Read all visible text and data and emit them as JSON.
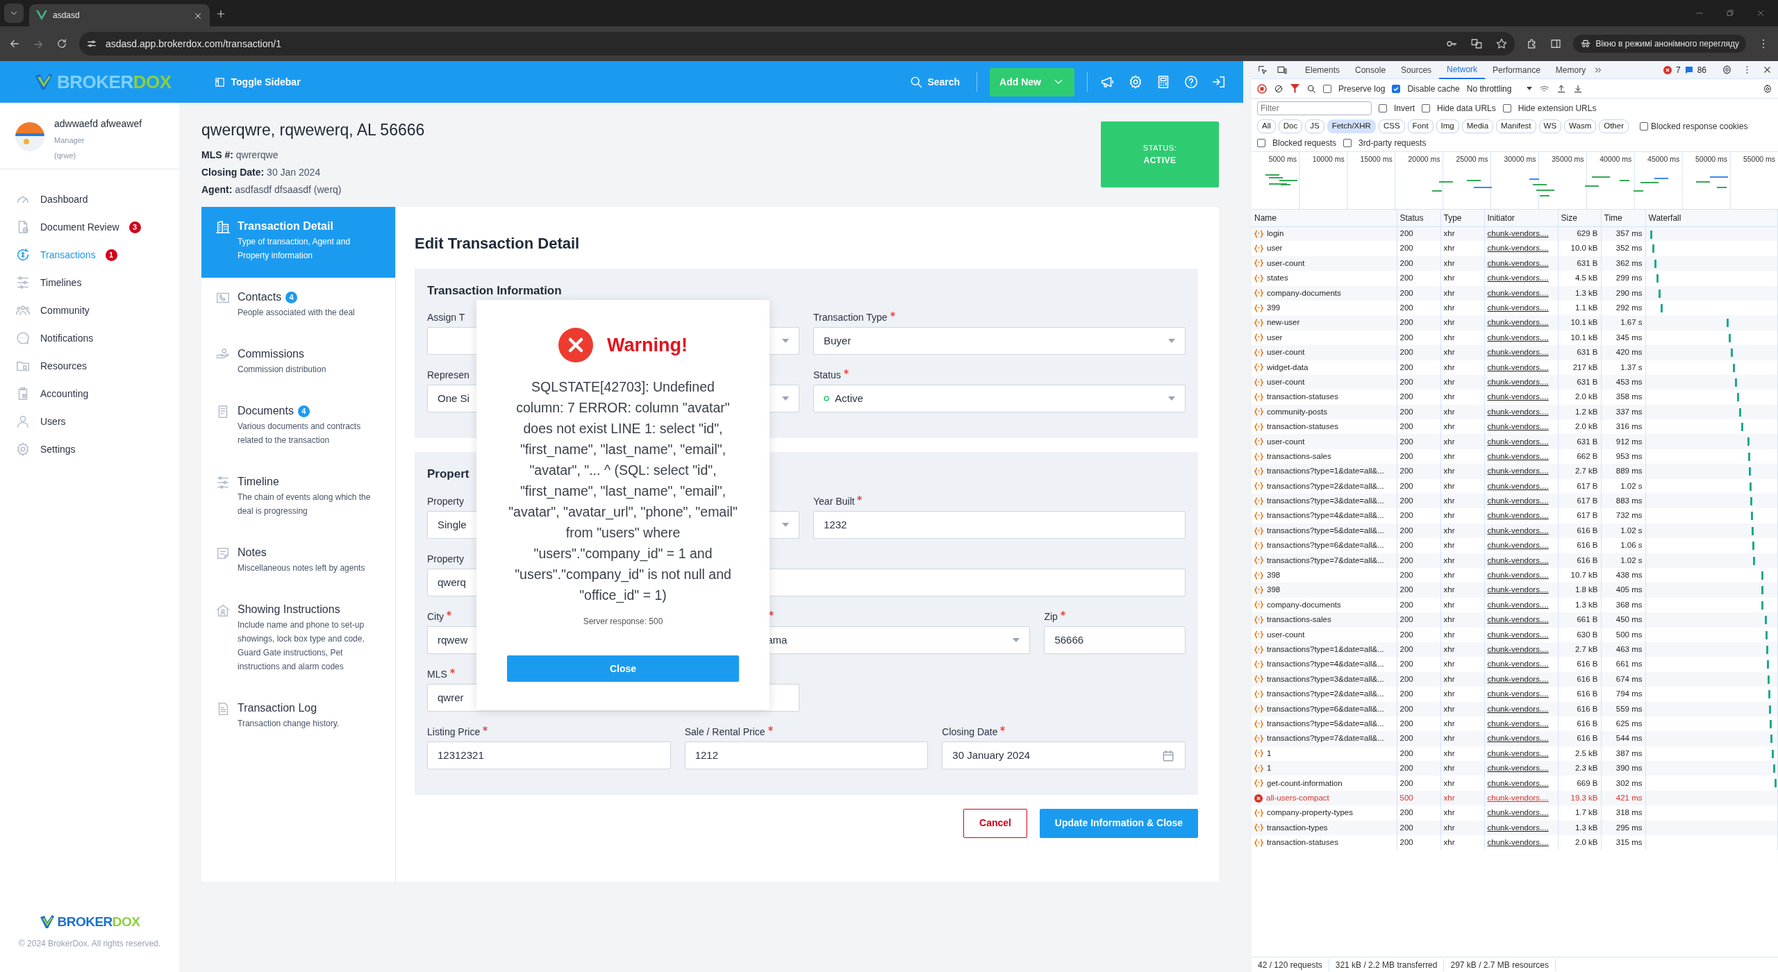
{
  "browser": {
    "tab_title": "asdasd",
    "url": "asdasd.app.brokerdox.com/transaction/1",
    "incognito_label": "Вікно в режимі анонімного перегляду"
  },
  "app": {
    "logo": {
      "part_1": "BROKER",
      "part_2": "DOX"
    },
    "toggle_sidebar": "Toggle Sidebar",
    "search": "Search",
    "add_new": "Add New",
    "user": {
      "name": "adwwaefd afweawef",
      "role": "Manager",
      "office": "(qrwe)"
    },
    "sidebar": {
      "items": [
        {
          "label": "Dashboard",
          "selected": false
        },
        {
          "label": "Document Review",
          "badge": "3",
          "selected": false
        },
        {
          "label": "Transactions",
          "badge": "1",
          "selected": true
        },
        {
          "label": "Timelines",
          "selected": false
        },
        {
          "label": "Community",
          "selected": false
        },
        {
          "label": "Notifications",
          "selected": false
        },
        {
          "label": "Resources",
          "selected": false
        },
        {
          "label": "Accounting",
          "selected": false
        },
        {
          "label": "Users",
          "selected": false
        },
        {
          "label": "Settings",
          "selected": false
        }
      ]
    },
    "footer": {
      "logo": {
        "part_1": "BROKER",
        "part_2": "DOX"
      },
      "copyright": "© 2024 BrokerDox. All rights reserved."
    },
    "transaction": {
      "title": "qwerqwre, rqwewerq, AL 56666",
      "details": [
        "**MLS #:** qwrerqwe",
        "**Closing Date:** 30 Jan 2024",
        "**Agent:** asdfasdf dfsaasdf (werq)"
      ],
      "status": {
        "label": "STATUS:",
        "value": "ACTIVE"
      }
    },
    "detail_nav": [
      {
        "title": "Transaction Detail",
        "description": "Type of transaction, Agent and Property information",
        "selected": true
      },
      {
        "title": "Contacts",
        "badge": "4",
        "description": "People associated with the deal",
        "selected": false
      },
      {
        "title": "Commissions",
        "description": "Commission distribution",
        "selected": false
      },
      {
        "title": "Documents",
        "badge": "4",
        "description": "Various documents and contracts related to the transaction",
        "selected": false
      },
      {
        "title": "Timeline",
        "description": "The chain of events along which the deal is progressing",
        "selected": false
      },
      {
        "title": "Notes",
        "description": "Miscellaneous notes left by agents",
        "selected": false
      },
      {
        "title": "Showing Instructions",
        "description": "Include name and phone to set-up showings, lock box type and code, Guard Gate instructions, Pet instructions and alarm codes",
        "selected": false
      },
      {
        "title": "Transaction Log",
        "description": "Transaction change history.",
        "selected": false
      }
    ],
    "form": {
      "title": "Edit Transaction Detail",
      "sections": [
        {
          "title": "Transaction Information",
          "rows": [
            {
              "kind": "pair",
              "fields": [
                {
                  "label": "Assign T",
                  "required": false,
                  "kind": "select"
                },
                {
                  "label": "Transaction Type",
                  "required": true,
                  "value": "Buyer",
                  "kind": "select"
                }
              ]
            },
            {
              "kind": "pair",
              "fields": [
                {
                  "label": "Represen",
                  "required": false,
                  "value": "One Si",
                  "kind": "select"
                },
                {
                  "label": "Status",
                  "required": true,
                  "value": "Active",
                  "kind": "status"
                }
              ]
            }
          ]
        },
        {
          "title": "Propert",
          "rows": [
            {
              "kind": "pair",
              "fields": [
                {
                  "label": "Property",
                  "required": false,
                  "value": "Single",
                  "kind": "select"
                },
                {
                  "label": "Year Built",
                  "required": true,
                  "value": "1232",
                  "kind": "input"
                }
              ]
            },
            {
              "kind": "wide",
              "fields": [
                {
                  "label": "Property",
                  "required": false,
                  "value": "qwerq",
                  "kind": "input"
                }
              ]
            },
            {
              "kind": "address",
              "fields": [
                {
                  "label": "City",
                  "required": true,
                  "value": "rqwew",
                  "kind": "input"
                },
                {
                  "required": true,
                  "value": "ama",
                  "kind": "covered-select"
                },
                {
                  "label": "Zip",
                  "required": true,
                  "value": "56666",
                  "kind": "input"
                }
              ]
            },
            {
              "kind": "half",
              "fields": [
                {
                  "label": "MLS",
                  "required": true,
                  "value": "qwrer",
                  "kind": "input"
                }
              ]
            },
            {
              "kind": "triple",
              "fields": [
                {
                  "label": "Listing Price",
                  "required": true,
                  "value": "12312321",
                  "kind": "input"
                },
                {
                  "label": "Sale / Rental Price",
                  "required": true,
                  "value": "1212",
                  "kind": "input"
                },
                {
                  "label": "Closing Date",
                  "required": true,
                  "value": "30 January 2024",
                  "kind": "date"
                }
              ]
            }
          ]
        }
      ],
      "cancel": "Cancel",
      "submit": "Update Information & Close"
    },
    "modal": {
      "title": "Warning!",
      "message": "SQLSTATE[42703]: Undefined column: 7 ERROR: column \"avatar\" does not exist LINE 1: select \"id\", \"first_name\", \"last_name\", \"email\", \"avatar\", \"... ^ (SQL: select \"id\", \"first_name\", \"last_name\", \"email\", \"avatar\", \"avatar_url\", \"phone\", \"email\" from \"users\" where \"users\".\"company_id\" = 1 and \"users\".\"company_id\" is not null and \"office_id\" = 1)",
      "server_response": "Server response: 500",
      "close": "Close"
    }
  },
  "devtools": {
    "tabs": [
      {
        "label": "Elements",
        "selected": false
      },
      {
        "label": "Console",
        "selected": false
      },
      {
        "label": "Sources",
        "selected": false
      },
      {
        "label": "Network",
        "selected": true
      },
      {
        "label": "Performance",
        "selected": false
      },
      {
        "label": "Memory",
        "selected": false
      }
    ],
    "error_count": "7",
    "message_count": "86",
    "preserve_log": {
      "label": "Preserve log",
      "checked": false
    },
    "disable_cache": {
      "label": "Disable cache",
      "checked": true
    },
    "throttling": "No throttling",
    "filter": {
      "placeholder": "Filter"
    },
    "filter_options": [
      {
        "label": "Invert",
        "checked": false
      },
      {
        "label": "Hide data URLs",
        "checked": false
      },
      {
        "label": "Hide extension URLs",
        "checked": false
      }
    ],
    "type_filters": [
      {
        "label": "All",
        "selected": false
      },
      {
        "label": "Doc",
        "selected": false
      },
      {
        "label": "JS",
        "selected": false
      },
      {
        "label": "Fetch/XHR",
        "selected": true
      },
      {
        "label": "CSS",
        "selected": false
      },
      {
        "label": "Font",
        "selected": false
      },
      {
        "label": "Img",
        "selected": false
      },
      {
        "label": "Media",
        "selected": false
      },
      {
        "label": "Manifest",
        "selected": false
      },
      {
        "label": "WS",
        "selected": false
      },
      {
        "label": "Wasm",
        "selected": false
      },
      {
        "label": "Other",
        "selected": false
      }
    ],
    "blocked_cookies": {
      "label": "Blocked response cookies",
      "checked": false
    },
    "request_options": [
      {
        "label": "Blocked requests",
        "checked": false
      },
      {
        "label": "3rd-party requests",
        "checked": false
      }
    ],
    "overview_ticks": [
      "5000 ms",
      "10000 ms",
      "15000 ms",
      "20000 ms",
      "25000 ms",
      "30000 ms",
      "35000 ms",
      "40000 ms",
      "45000 ms",
      "50000 ms",
      "55000 ms"
    ],
    "columns": [
      "Name",
      "Status",
      "Type",
      "Initiator",
      "Size",
      "Time",
      "Waterfall"
    ],
    "requests": [
      {
        "name": "login",
        "status": "200",
        "type": "xhr",
        "initiator": "chunk-vendors....",
        "size": "629 B",
        "time": "357 ms",
        "failed": false
      },
      {
        "name": "user",
        "status": "200",
        "type": "xhr",
        "initiator": "chunk-vendors....",
        "size": "10.0 kB",
        "time": "352 ms",
        "failed": false
      },
      {
        "name": "user-count",
        "status": "200",
        "type": "xhr",
        "initiator": "chunk-vendors....",
        "size": "631 B",
        "time": "362 ms",
        "failed": false
      },
      {
        "name": "states",
        "status": "200",
        "type": "xhr",
        "initiator": "chunk-vendors....",
        "size": "4.5 kB",
        "time": "299 ms",
        "failed": false
      },
      {
        "name": "company-documents",
        "status": "200",
        "type": "xhr",
        "initiator": "chunk-vendors....",
        "size": "1.3 kB",
        "time": "290 ms",
        "failed": false
      },
      {
        "name": "399",
        "status": "200",
        "type": "xhr",
        "initiator": "chunk-vendors....",
        "size": "1.1 kB",
        "time": "292 ms",
        "failed": false
      },
      {
        "name": "new-user",
        "status": "200",
        "type": "xhr",
        "initiator": "chunk-vendors....",
        "size": "10.1 kB",
        "time": "1.67 s",
        "failed": false
      },
      {
        "name": "user",
        "status": "200",
        "type": "xhr",
        "initiator": "chunk-vendors....",
        "size": "10.1 kB",
        "time": "345 ms",
        "failed": false
      },
      {
        "name": "user-count",
        "status": "200",
        "type": "xhr",
        "initiator": "chunk-vendors....",
        "size": "631 B",
        "time": "420 ms",
        "failed": false
      },
      {
        "name": "widget-data",
        "status": "200",
        "type": "xhr",
        "initiator": "chunk-vendors....",
        "size": "217 kB",
        "time": "1.37 s",
        "failed": false
      },
      {
        "name": "user-count",
        "status": "200",
        "type": "xhr",
        "initiator": "chunk-vendors....",
        "size": "631 B",
        "time": "453 ms",
        "failed": false
      },
      {
        "name": "transaction-statuses",
        "status": "200",
        "type": "xhr",
        "initiator": "chunk-vendors....",
        "size": "2.0 kB",
        "time": "358 ms",
        "failed": false
      },
      {
        "name": "community-posts",
        "status": "200",
        "type": "xhr",
        "initiator": "chunk-vendors....",
        "size": "1.2 kB",
        "time": "337 ms",
        "failed": false
      },
      {
        "name": "transaction-statuses",
        "status": "200",
        "type": "xhr",
        "initiator": "chunk-vendors....",
        "size": "2.0 kB",
        "time": "316 ms",
        "failed": false
      },
      {
        "name": "user-count",
        "status": "200",
        "type": "xhr",
        "initiator": "chunk-vendors....",
        "size": "631 B",
        "time": "912 ms",
        "failed": false
      },
      {
        "name": "transactions-sales",
        "status": "200",
        "type": "xhr",
        "initiator": "chunk-vendors....",
        "size": "662 B",
        "time": "953 ms",
        "failed": false
      },
      {
        "name": "transactions?type=1&date=all&...",
        "status": "200",
        "type": "xhr",
        "initiator": "chunk-vendors....",
        "size": "2.7 kB",
        "time": "889 ms",
        "failed": false
      },
      {
        "name": "transactions?type=2&date=all&...",
        "status": "200",
        "type": "xhr",
        "initiator": "chunk-vendors....",
        "size": "617 B",
        "time": "1.02 s",
        "failed": false
      },
      {
        "name": "transactions?type=3&date=all&...",
        "status": "200",
        "type": "xhr",
        "initiator": "chunk-vendors....",
        "size": "617 B",
        "time": "883 ms",
        "failed": false
      },
      {
        "name": "transactions?type=4&date=all&...",
        "status": "200",
        "type": "xhr",
        "initiator": "chunk-vendors....",
        "size": "617 B",
        "time": "732 ms",
        "failed": false
      },
      {
        "name": "transactions?type=5&date=all&...",
        "status": "200",
        "type": "xhr",
        "initiator": "chunk-vendors....",
        "size": "616 B",
        "time": "1.02 s",
        "failed": false
      },
      {
        "name": "transactions?type=6&date=all&...",
        "status": "200",
        "type": "xhr",
        "initiator": "chunk-vendors....",
        "size": "616 B",
        "time": "1.06 s",
        "failed": false
      },
      {
        "name": "transactions?type=7&date=all&...",
        "status": "200",
        "type": "xhr",
        "initiator": "chunk-vendors....",
        "size": "616 B",
        "time": "1.02 s",
        "failed": false
      },
      {
        "name": "398",
        "status": "200",
        "type": "xhr",
        "initiator": "chunk-vendors....",
        "size": "10.7 kB",
        "time": "438 ms",
        "failed": false
      },
      {
        "name": "398",
        "status": "200",
        "type": "xhr",
        "initiator": "chunk-vendors....",
        "size": "1.8 kB",
        "time": "405 ms",
        "failed": false
      },
      {
        "name": "company-documents",
        "status": "200",
        "type": "xhr",
        "initiator": "chunk-vendors....",
        "size": "1.3 kB",
        "time": "368 ms",
        "failed": false
      },
      {
        "name": "transactions-sales",
        "status": "200",
        "type": "xhr",
        "initiator": "chunk-vendors....",
        "size": "661 B",
        "time": "450 ms",
        "failed": false
      },
      {
        "name": "user-count",
        "status": "200",
        "type": "xhr",
        "initiator": "chunk-vendors....",
        "size": "630 B",
        "time": "500 ms",
        "failed": false
      },
      {
        "name": "transactions?type=1&date=all&...",
        "status": "200",
        "type": "xhr",
        "initiator": "chunk-vendors....",
        "size": "2.7 kB",
        "time": "463 ms",
        "failed": false
      },
      {
        "name": "transactions?type=4&date=all&...",
        "status": "200",
        "type": "xhr",
        "initiator": "chunk-vendors....",
        "size": "616 B",
        "time": "661 ms",
        "failed": false
      },
      {
        "name": "transactions?type=3&date=all&...",
        "status": "200",
        "type": "xhr",
        "initiator": "chunk-vendors....",
        "size": "616 B",
        "time": "674 ms",
        "failed": false
      },
      {
        "name": "transactions?type=2&date=all&...",
        "status": "200",
        "type": "xhr",
        "initiator": "chunk-vendors....",
        "size": "616 B",
        "time": "794 ms",
        "failed": false
      },
      {
        "name": "transactions?type=6&date=all&...",
        "status": "200",
        "type": "xhr",
        "initiator": "chunk-vendors....",
        "size": "616 B",
        "time": "559 ms",
        "failed": false
      },
      {
        "name": "transactions?type=5&date=all&...",
        "status": "200",
        "type": "xhr",
        "initiator": "chunk-vendors....",
        "size": "616 B",
        "time": "625 ms",
        "failed": false
      },
      {
        "name": "transactions?type=7&date=all&...",
        "status": "200",
        "type": "xhr",
        "initiator": "chunk-vendors....",
        "size": "616 B",
        "time": "544 ms",
        "failed": false
      },
      {
        "name": "1",
        "status": "200",
        "type": "xhr",
        "initiator": "chunk-vendors....",
        "size": "2.5 kB",
        "time": "387 ms",
        "failed": false
      },
      {
        "name": "1",
        "status": "200",
        "type": "xhr",
        "initiator": "chunk-vendors....",
        "size": "2.3 kB",
        "time": "390 ms",
        "failed": false
      },
      {
        "name": "get-count-information",
        "status": "200",
        "type": "xhr",
        "initiator": "chunk-vendors....",
        "size": "669 B",
        "time": "302 ms",
        "failed": false
      },
      {
        "name": "all-users-compact",
        "status": "500",
        "type": "xhr",
        "initiator": "chunk-vendors....",
        "size": "19.3 kB",
        "time": "421 ms",
        "failed": true
      },
      {
        "name": "company-property-types",
        "status": "200",
        "type": "xhr",
        "initiator": "chunk-vendors....",
        "size": "1.7 kB",
        "time": "318 ms",
        "failed": false
      },
      {
        "name": "transaction-types",
        "status": "200",
        "type": "xhr",
        "initiator": "chunk-vendors....",
        "size": "1.3 kB",
        "time": "295 ms",
        "failed": false
      },
      {
        "name": "transaction-statuses",
        "status": "200",
        "type": "xhr",
        "initiator": "chunk-vendors....",
        "size": "2.0 kB",
        "time": "315 ms",
        "failed": false
      }
    ],
    "summary": [
      "42 / 120 requests",
      "321 kB / 2.2 MB transferred",
      "297 kB / 2.7 MB resources"
    ]
  }
}
